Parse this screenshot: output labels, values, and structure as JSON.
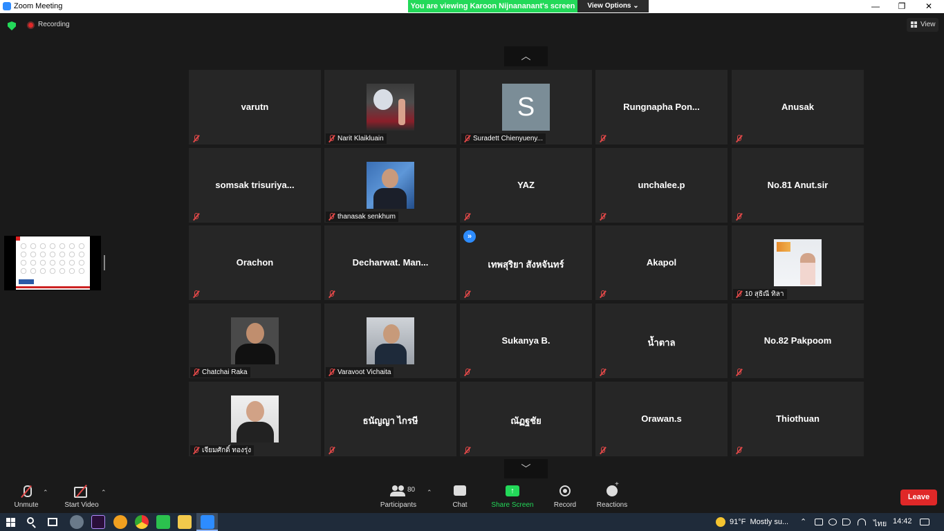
{
  "window": {
    "title": "Zoom Meeting",
    "minimize_glyph": "—",
    "restore_glyph": "❐",
    "close_glyph": "✕"
  },
  "share_banner": {
    "viewing_text": "You are viewing Karoon Nijnananant's screen",
    "view_options_label": "View Options ⌄"
  },
  "status": {
    "recording_label": "Recording",
    "view_label": "View",
    "security_icon": "shield-icon",
    "recording_icon": "record-dot-icon"
  },
  "pager": {
    "up_glyph": "︿",
    "down_glyph": "﹀"
  },
  "tiles": [
    {
      "name": "varutn",
      "nameplate": ""
    },
    {
      "name": "",
      "nameplate": "Narit Klaikluain"
    },
    {
      "name": "",
      "nameplate": "Suradett Chienyueny...",
      "initial": "S"
    },
    {
      "name": "Rungnapha  Pon...",
      "nameplate": ""
    },
    {
      "name": "Anusak",
      "nameplate": ""
    },
    {
      "name": "somsak  trisuriya...",
      "nameplate": ""
    },
    {
      "name": "",
      "nameplate": "thanasak senkhum"
    },
    {
      "name": "YAZ",
      "nameplate": ""
    },
    {
      "name": "unchalee.p",
      "nameplate": ""
    },
    {
      "name": "No.81 Anut.sir",
      "nameplate": ""
    },
    {
      "name": "Orachon",
      "nameplate": ""
    },
    {
      "name": "Decharwat.  Man...",
      "nameplate": ""
    },
    {
      "name": "เทพสุริยา สังหจันทร์",
      "nameplate": "",
      "spotlight_glyph": "»"
    },
    {
      "name": "Akapol",
      "nameplate": ""
    },
    {
      "name": "",
      "nameplate": "10 สุธิณี ทิลา"
    },
    {
      "name": "",
      "nameplate": "Chatchai Raka"
    },
    {
      "name": "",
      "nameplate": "Varavoot Vichaita"
    },
    {
      "name": "Sukanya B.",
      "nameplate": ""
    },
    {
      "name": "น้ำตาล",
      "nameplate": ""
    },
    {
      "name": "No.82 Pakpoom",
      "nameplate": ""
    },
    {
      "name": "",
      "nameplate": "เจียมศักดิ์ ทองรุ่ง"
    },
    {
      "name": "ธนัญญา ไกรษี",
      "nameplate": ""
    },
    {
      "name": "ณัฏฐชัย",
      "nameplate": ""
    },
    {
      "name": "Orawan.s",
      "nameplate": ""
    },
    {
      "name": "Thiothuan",
      "nameplate": ""
    }
  ],
  "toolbar": {
    "unmute_label": "Unmute",
    "start_video_label": "Start Video",
    "participants_label": "Participants",
    "participants_count": "80",
    "chat_label": "Chat",
    "share_screen_label": "Share Screen",
    "share_glyph": "↑",
    "record_label": "Record",
    "reactions_label": "Reactions",
    "leave_label": "Leave",
    "caret_glyph": "⌃",
    "share_color": "#23d959",
    "leave_color": "#e02828"
  },
  "taskbar": {
    "weather_temp": "91°F",
    "weather_text": "Mostly su...",
    "language": "ไทย",
    "time": "14:42",
    "tray_up_glyph": "⌃"
  }
}
